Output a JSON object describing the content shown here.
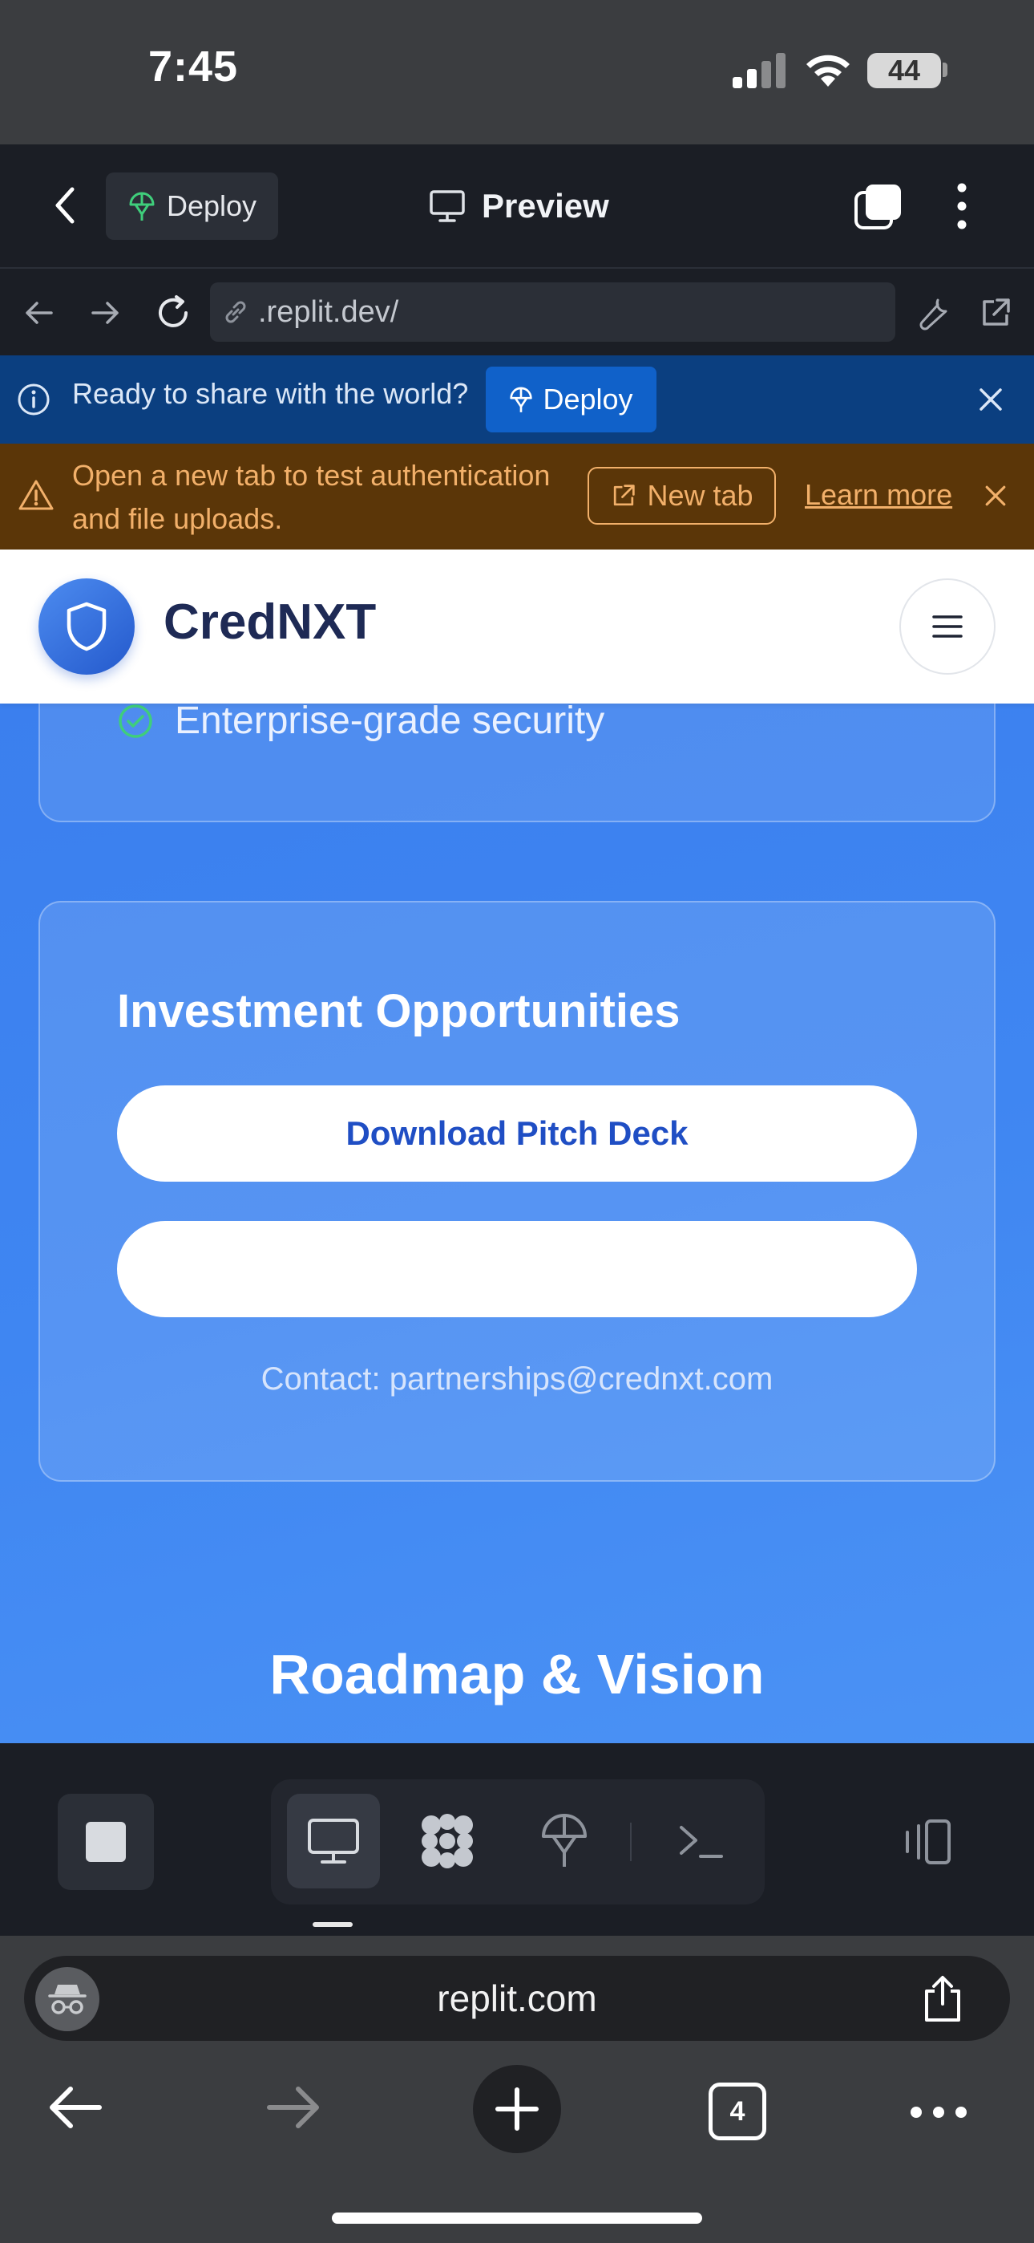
{
  "status_bar": {
    "time": "7:45",
    "battery": "44"
  },
  "replit_header": {
    "deploy_label": "Deploy",
    "title": "Preview"
  },
  "url_bar": {
    "url": ".replit.dev/"
  },
  "share_banner": {
    "text": "Ready to share with the world?",
    "button": "Deploy"
  },
  "auth_banner": {
    "line1": "Open a new tab to test authentication",
    "line2": "and file uploads.",
    "new_tab": "New tab",
    "learn_more": "Learn more"
  },
  "site": {
    "brand": "CredNXT",
    "feature": "Enterprise-grade security",
    "invest_title": "Investment Opportunities",
    "pitch_button": "Download Pitch Deck",
    "second_button": "",
    "contact": "Contact: partnerships@crednxt.com",
    "roadmap_title": "Roadmap & Vision"
  },
  "safari": {
    "address": "replit.com",
    "tab_count": "4"
  },
  "colors": {
    "brand_blue": "#3b7fee",
    "banner_blue": "#0b3f80",
    "banner_orange": "#5b3608",
    "accent_orange": "#f2b06a",
    "deploy_green": "#3fce7b"
  },
  "icons": [
    "back-chevron-icon",
    "deploy-icon",
    "monitor-icon",
    "tabs-icon",
    "kebab-icon",
    "back-arrow-icon",
    "forward-arrow-icon",
    "reload-icon",
    "link-icon",
    "wrench-icon",
    "external-link-icon",
    "info-icon",
    "close-icon",
    "warning-icon",
    "shield-icon",
    "menu-icon",
    "check-circle-icon",
    "stop-icon",
    "extensions-icon",
    "shell-icon",
    "layout-icon",
    "incognito-icon",
    "share-icon",
    "plus-icon"
  ]
}
